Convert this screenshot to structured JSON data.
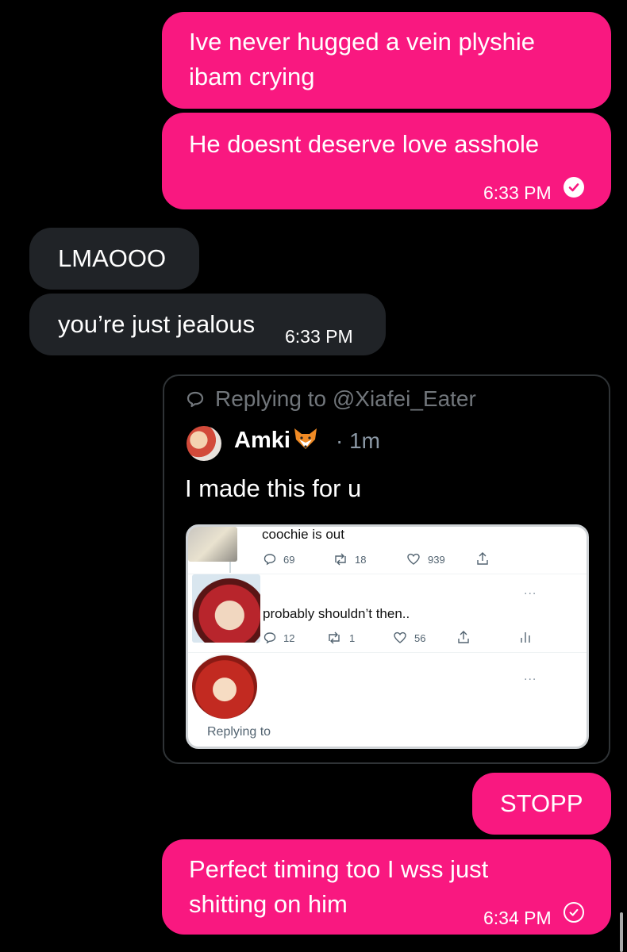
{
  "messages": {
    "m1": {
      "line1": "Ive never hugged a vein plyshie",
      "line2": "ibam crying"
    },
    "m2": {
      "text": "He doesnt deserve love asshole",
      "time": "6:33 PM"
    },
    "m3": {
      "text": "LMAOOO"
    },
    "m4": {
      "text": "you’re just jealous",
      "time": "6:33 PM"
    },
    "m5": {
      "text": "STOPP"
    },
    "m6": {
      "line1": "Perfect timing too I wss just",
      "line2": "shitting on him",
      "time": "6:34 PM"
    }
  },
  "quote_card": {
    "replying_to": "Replying to @Xiafei_Eater",
    "author": "Amki",
    "author_emoji": "fox-icon",
    "time_ago": "· 1m",
    "text": "I made this for u",
    "embedded": {
      "post1": {
        "text": "coochie is out",
        "replies": "69",
        "reposts": "18",
        "likes": "939"
      },
      "post2": {
        "text": "probably shouldn’t then..",
        "replies": "12",
        "reposts": "1",
        "likes": "56",
        "more": "...",
        "views_icon": "chart-icon"
      },
      "post3": {
        "more": "...",
        "replying": "Replying to"
      }
    }
  },
  "colors": {
    "outgoing_bubble": "#f91880",
    "incoming_bubble": "#202327",
    "background": "#000000"
  }
}
